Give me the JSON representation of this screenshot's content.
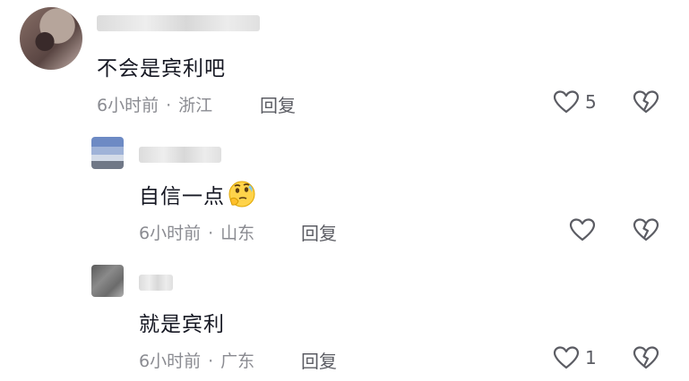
{
  "comments": [
    {
      "text": "不会是宾利吧",
      "time": "6小时前",
      "separator": "·",
      "location": "浙江",
      "reply_label": "回复",
      "like_count": "5"
    },
    {
      "text": "自信一点",
      "time": "6小时前",
      "separator": "·",
      "location": "山东",
      "reply_label": "回复",
      "like_count": ""
    },
    {
      "text": "就是宾利",
      "time": "6小时前",
      "separator": "·",
      "location": "广东",
      "reply_label": "回复",
      "like_count": "1"
    }
  ],
  "icons": {
    "like": "heart-outline-icon",
    "dislike": "broken-heart-icon",
    "emoji": "thinking-face-emoji"
  },
  "colors": {
    "text": "#161823",
    "meta": "#8a8b91",
    "icon": "#5b5c63"
  }
}
